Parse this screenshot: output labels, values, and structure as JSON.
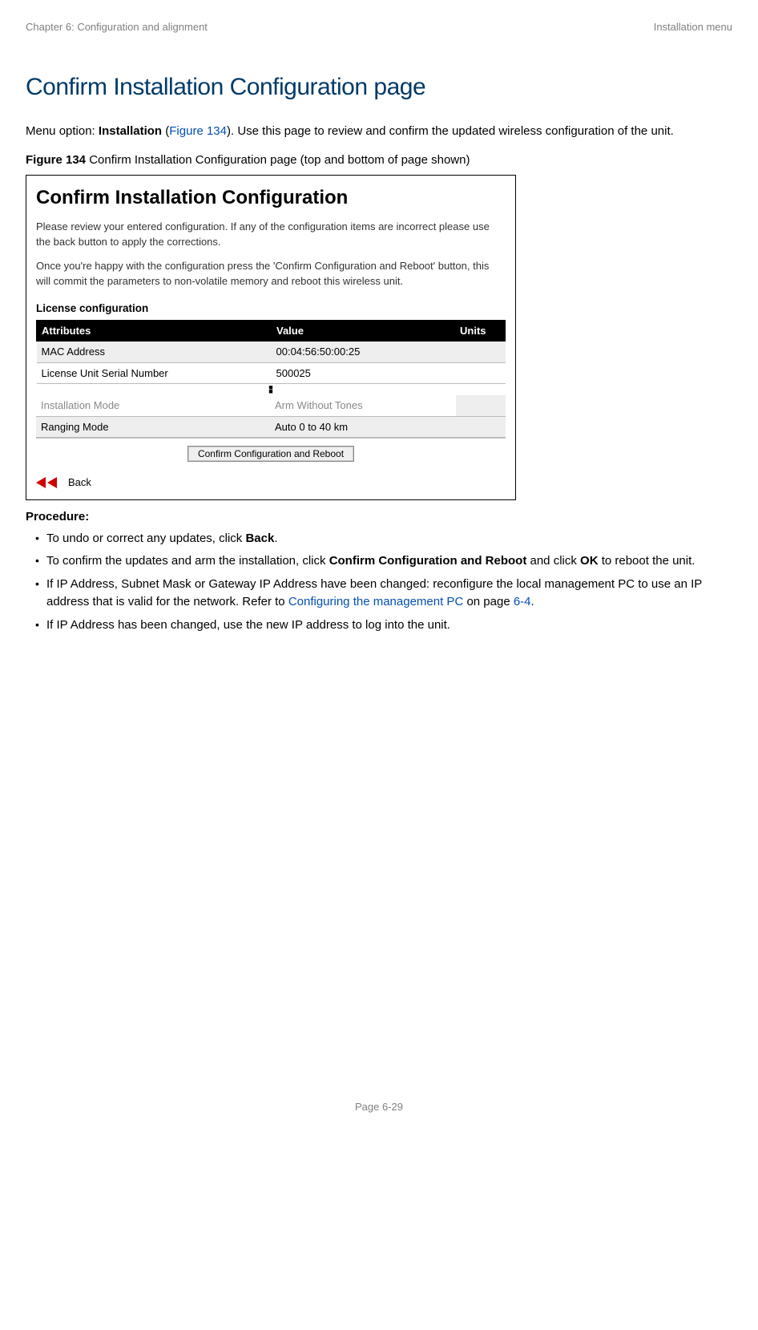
{
  "header": {
    "chapter": "Chapter 6:  Configuration and alignment",
    "section": "Installation menu"
  },
  "title": "Confirm Installation Configuration page",
  "intro": {
    "prefix": "Menu option: ",
    "bold1": "Installation",
    "paren_open": " (",
    "figref": "Figure 134",
    "paren_close": "). Use this page to review and confirm the updated wireless configuration of the unit."
  },
  "figure": {
    "label_bold": "Figure 134",
    "label_rest": "  Confirm Installation Configuration page (top and bottom of page shown)"
  },
  "cic": {
    "heading": "Confirm Installation Configuration",
    "p1": "Please review your entered configuration. If any of the configuration items are incorrect please use the back button to apply the corrections.",
    "p2": "Once you're happy with the configuration press the 'Confirm Configuration and Reboot' button, this will commit the parameters to non-volatile memory and reboot this wireless unit.",
    "license_label": "License configuration",
    "headers": {
      "attr": "Attributes",
      "val": "Value",
      "unit": "Units"
    },
    "rows_top": [
      {
        "attr": "MAC Address",
        "val": "00:04:56:50:00:25",
        "unit": ""
      },
      {
        "attr": "License Unit Serial Number",
        "val": "500025",
        "unit": ""
      }
    ],
    "rows_bottom": [
      {
        "attr": "Installation Mode",
        "val": "Arm Without Tones",
        "unit": ""
      },
      {
        "attr": "Ranging Mode",
        "val": "Auto 0 to 40 km",
        "unit": ""
      }
    ],
    "button": "Confirm Configuration and Reboot",
    "back": "Back"
  },
  "procedure": {
    "heading": "Procedure:",
    "items": [
      {
        "t1": "To undo or correct any updates, click ",
        "b1": "Back",
        "t2": "."
      },
      {
        "t1": "To confirm the updates and arm the installation, click ",
        "b1": "Confirm Configuration and Reboot",
        "t2": " and click ",
        "b2": "OK",
        "t3": " to reboot the unit."
      },
      {
        "t1": "If IP Address, Subnet Mask or Gateway IP Address have been changed: reconfigure the local management PC to use an IP address that is valid for the network. Refer to ",
        "l1": "Configuring the management PC",
        "t2": " on page ",
        "l2": "6-4",
        "t3": "."
      },
      {
        "t1": "If IP Address has been changed, use the new IP address to log into the unit."
      }
    ]
  },
  "footer": "Page 6-29"
}
